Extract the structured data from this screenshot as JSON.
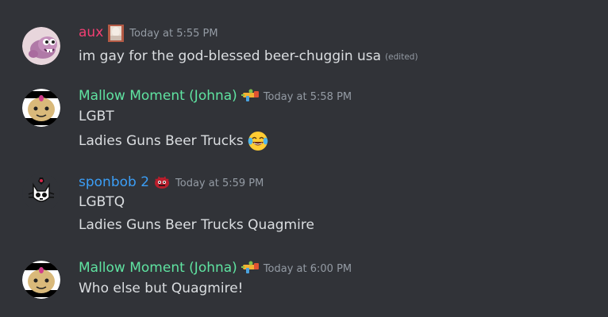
{
  "messages": [
    {
      "username": "aux",
      "name_color": "#f23f73",
      "timestamp": "Today at 5:55 PM",
      "lines": [
        "im gay for the god-blessed beer-chuggin usa"
      ],
      "edited_label": "(edited)",
      "avatar_icon": "pink-creature-avatar",
      "badge_icon": "profile-image-badge"
    },
    {
      "username": "Mallow Moment (Johna)",
      "name_color": "#5fe3a1",
      "timestamp": "Today at 5:58 PM",
      "lines": [
        "LGBT",
        "Ladies Guns Beer Trucks"
      ],
      "avatar_icon": "mallow-avatar",
      "badge_icon": "water-gun-icon",
      "emoji": "face-with-tears-of-joy"
    },
    {
      "username": "sponbob 2",
      "name_color": "#3b9ef6",
      "timestamp": "Today at 5:59 PM",
      "lines": [
        "LGBTQ",
        "Ladies Guns Beer Trucks Quagmire"
      ],
      "avatar_icon": "cat-skull-avatar",
      "badge_icon": "red-creature-icon"
    },
    {
      "username": "Mallow Moment (Johna)",
      "name_color": "#5fe3a1",
      "timestamp": "Today at 6:00 PM",
      "lines": [
        "Who else but Quagmire!"
      ],
      "avatar_icon": "mallow-avatar",
      "badge_icon": "water-gun-icon"
    }
  ]
}
